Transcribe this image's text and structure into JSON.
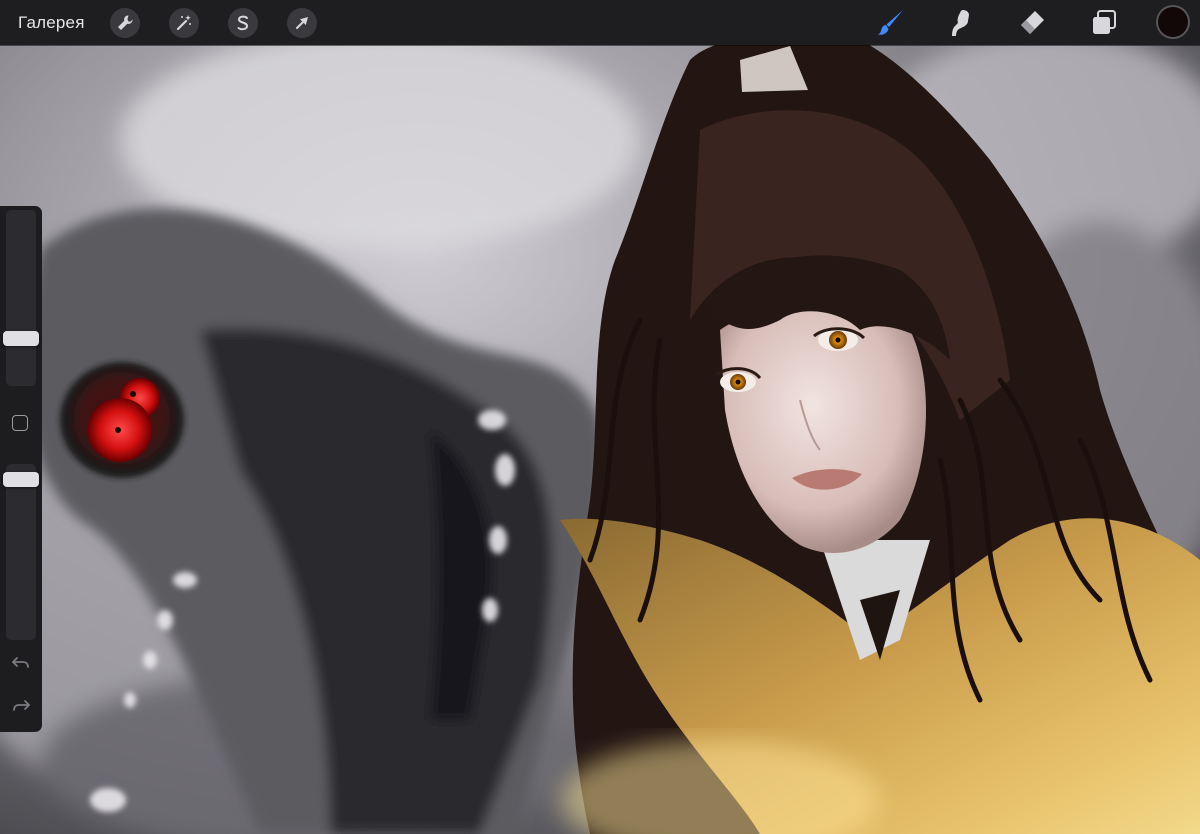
{
  "toolbar": {
    "gallery_label": "Галерея",
    "left_tools": [
      {
        "icon": "wrench-icon",
        "name": "actions"
      },
      {
        "icon": "magic-wand-icon",
        "name": "adjustments"
      },
      {
        "icon": "selection-s-icon",
        "name": "selection"
      },
      {
        "icon": "arrow-cursor-icon",
        "name": "transform"
      }
    ],
    "right_tools": [
      {
        "icon": "brush-icon",
        "name": "brush",
        "active": true
      },
      {
        "icon": "smudge-icon",
        "name": "smudge",
        "active": false
      },
      {
        "icon": "eraser-icon",
        "name": "eraser",
        "active": false
      },
      {
        "icon": "layers-icon",
        "name": "layers",
        "active": false
      }
    ],
    "current_color": "#120808"
  },
  "sidebar": {
    "brush_size": 0.25,
    "brush_opacity": 0.95,
    "modifier_icon": "square-icon",
    "undo_icon": "undo-icon",
    "redo_icon": "redo-icon"
  },
  "colors": {
    "toolbar_bg": "#1e1e20",
    "accent_active": "#3d8bff",
    "icon_default": "#d8d8dc"
  }
}
